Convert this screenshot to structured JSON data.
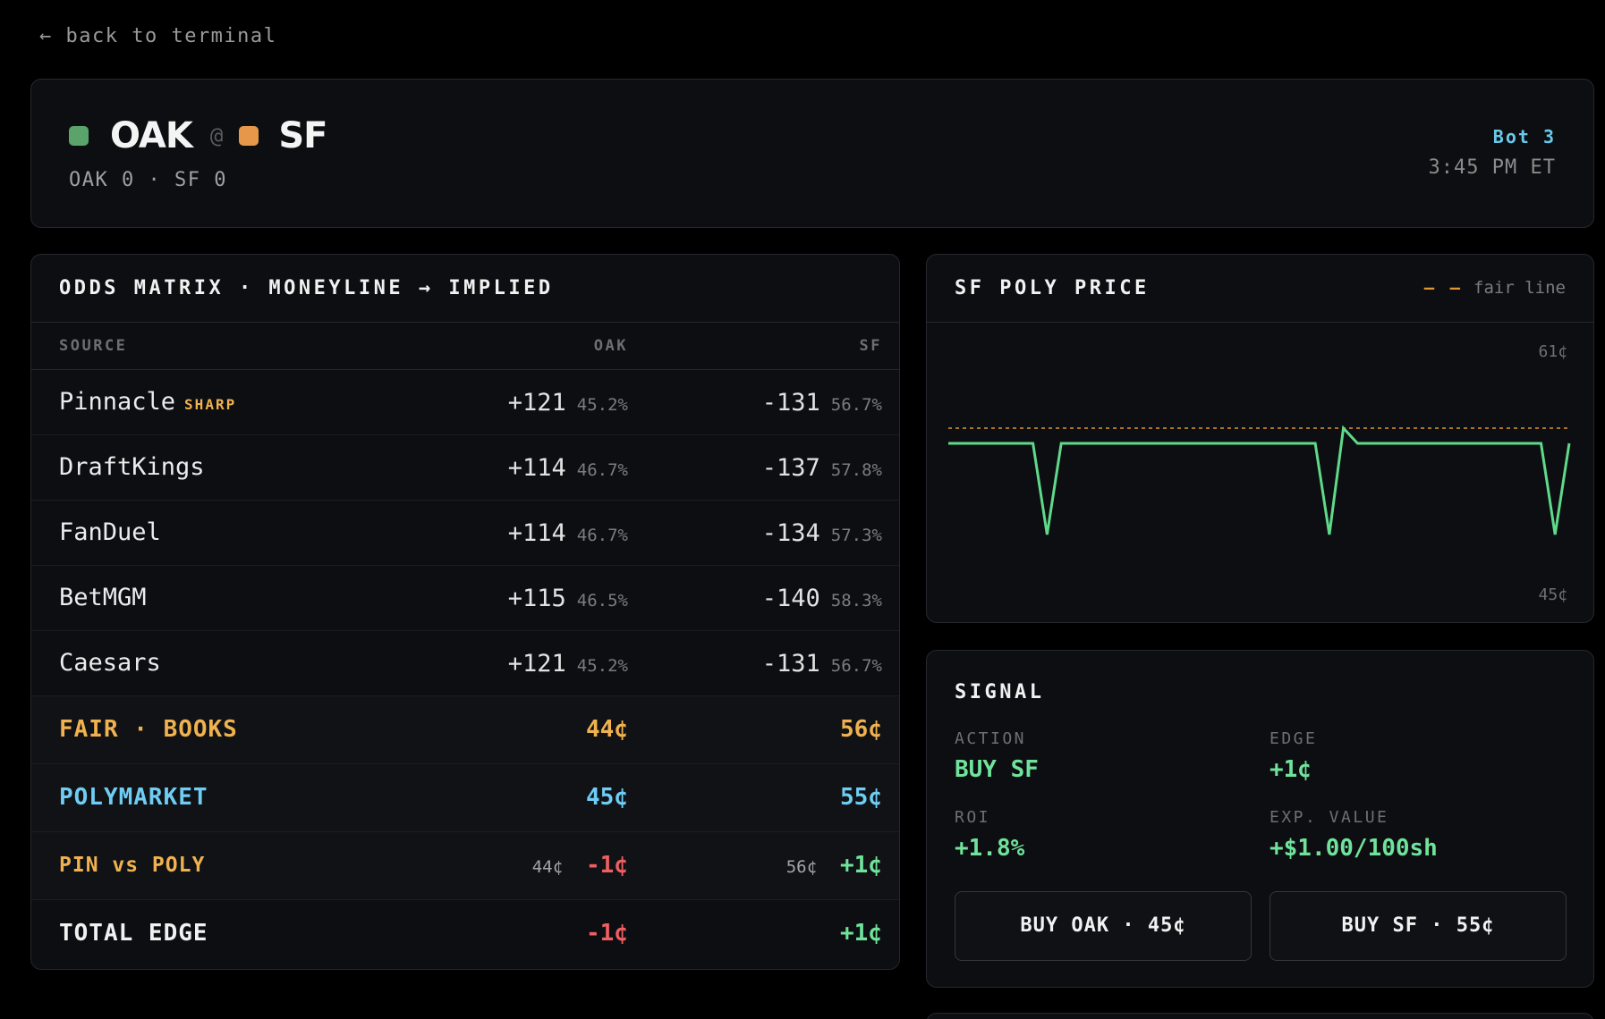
{
  "nav": {
    "back_label": "← back to terminal"
  },
  "header": {
    "away_team": "OAK",
    "home_team": "SF",
    "at": "@",
    "score": "OAK 0 · SF 0",
    "inning": "Bot 3",
    "time": "3:45 PM ET",
    "colors": {
      "away": "#5aa46c",
      "home": "#e7974a"
    }
  },
  "odds": {
    "title": "ODDS MATRIX · MONEYLINE → IMPLIED",
    "columns": {
      "source": "SOURCE",
      "away": "OAK",
      "home": "SF"
    },
    "sharp_tag": "SHARP",
    "rows": [
      {
        "source": "Pinnacle",
        "away_line": "+121",
        "away_pct": "45.2%",
        "home_line": "-131",
        "home_pct": "56.7%"
      },
      {
        "source": "DraftKings",
        "away_line": "+114",
        "away_pct": "46.7%",
        "home_line": "-137",
        "home_pct": "57.8%"
      },
      {
        "source": "FanDuel",
        "away_line": "+114",
        "away_pct": "46.7%",
        "home_line": "-134",
        "home_pct": "57.3%"
      },
      {
        "source": "BetMGM",
        "away_line": "+115",
        "away_pct": "46.5%",
        "home_line": "-140",
        "home_pct": "58.3%"
      },
      {
        "source": "Caesars",
        "away_line": "+121",
        "away_pct": "45.2%",
        "home_line": "-131",
        "home_pct": "56.7%"
      }
    ],
    "fair": {
      "label": "FAIR · BOOKS",
      "away": "44¢",
      "home": "56¢"
    },
    "poly": {
      "label": "POLYMARKET",
      "away": "45¢",
      "home": "55¢"
    },
    "pin_vs_poly": {
      "label": "PIN vs POLY",
      "away_ref": "44¢",
      "away_edge": "-1¢",
      "home_ref": "56¢",
      "home_edge": "+1¢"
    },
    "total": {
      "label": "TOTAL EDGE",
      "away": "-1¢",
      "home": "+1¢"
    }
  },
  "price_chart": {
    "title": "SF POLY PRICE",
    "legend": "fair line",
    "y_max_label": "61¢",
    "y_min_label": "45¢"
  },
  "chart_data": {
    "type": "line",
    "ylim": [
      45,
      61
    ],
    "fair_line": 56,
    "series": [
      {
        "values": [
          55,
          55,
          55,
          55,
          55,
          55,
          55,
          49,
          55,
          55,
          55,
          55,
          55,
          55,
          55,
          55,
          55,
          55,
          55,
          55,
          55,
          55,
          55,
          55,
          55,
          55,
          55,
          49,
          56,
          55,
          55,
          55,
          55,
          55,
          55,
          55,
          55,
          55,
          55,
          55,
          55,
          55,
          55,
          49,
          55
        ]
      }
    ],
    "colors": {
      "series": "#5fd98a",
      "fair": "#e0962e"
    }
  },
  "signal": {
    "title": "SIGNAL",
    "action_label": "ACTION",
    "action": "BUY SF",
    "edge_label": "EDGE",
    "edge": "+1¢",
    "roi_label": "ROI",
    "roi": "+1.8%",
    "ev_label": "EXP. VALUE",
    "ev": "+$1.00/100sh",
    "buy_away": "BUY OAK · 45¢",
    "buy_home": "BUY SF · 55¢"
  }
}
